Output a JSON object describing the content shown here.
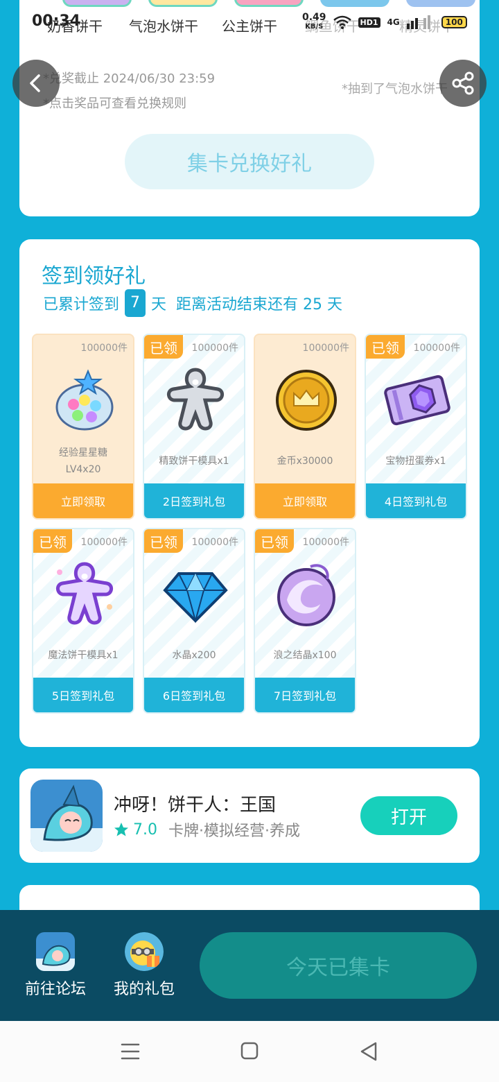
{
  "status_bar": {
    "time": "00:34",
    "speed_value": "0.49",
    "speed_unit": "KB/S",
    "hd": "HD1",
    "net": "4G",
    "battery": "100"
  },
  "top_card": {
    "cookie_labels": [
      "奶香饼干",
      "气泡水饼干",
      "公主饼干",
      "鲷鱼饼干",
      "精灵饼干"
    ],
    "redeem_deadline": "*兑奖截止 2024/06/30 23:59",
    "redeem_hint": "*点击奖品可查看兑换规则",
    "drawn_note": "*抽到了气泡水饼干",
    "collect_button": "集卡兑换好礼"
  },
  "sign_in": {
    "title": "签到领好礼",
    "prefix": "已累计签到",
    "days": "7",
    "day_unit": "天",
    "remaining": "距离活动结束还有 25 天",
    "gifts": [
      {
        "qty": "100000件",
        "name": "经验星星糖",
        "name2": "LV4x20",
        "action": "立即领取",
        "claimed": ""
      },
      {
        "qty": "100000件",
        "name": "精致饼干模具x1",
        "name2": "",
        "action": "2日签到礼包",
        "claimed": "已领"
      },
      {
        "qty": "100000件",
        "name": "金币x30000",
        "name2": "",
        "action": "立即领取",
        "claimed": ""
      },
      {
        "qty": "100000件",
        "name": "宝物扭蛋券x1",
        "name2": "",
        "action": "4日签到礼包",
        "claimed": "已领"
      },
      {
        "qty": "100000件",
        "name": "魔法饼干模具x1",
        "name2": "",
        "action": "5日签到礼包",
        "claimed": "已领"
      },
      {
        "qty": "100000件",
        "name": "水晶x200",
        "name2": "",
        "action": "6日签到礼包",
        "claimed": "已领"
      },
      {
        "qty": "100000件",
        "name": "浪之结晶x100",
        "name2": "",
        "action": "7日签到礼包",
        "claimed": "已领"
      }
    ]
  },
  "game": {
    "name": "冲呀！饼干人：王国",
    "rating": "7.0",
    "tags": "卡牌·模拟经营·养成",
    "open_button": "打开"
  },
  "bottom_bar": {
    "forum": "前往论坛",
    "my_gifts": "我的礼包",
    "today_button": "今天已集卡"
  },
  "colors": {
    "accent": "#1aa7d1",
    "orange": "#fbaa2f",
    "open": "#17d0bb",
    "bottom_bar": "#0b4b63"
  }
}
